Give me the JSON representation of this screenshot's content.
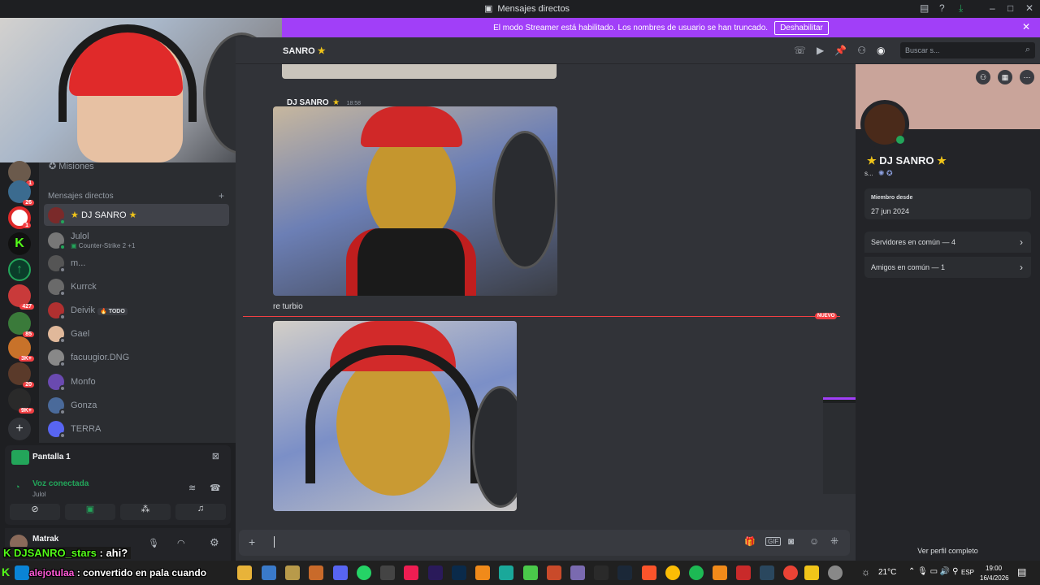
{
  "window": {
    "title": "Mensajes directos"
  },
  "banner": {
    "text": "El modo Streamer está habilitado. Los nombres de usuario se han truncado.",
    "button": "Deshabilitar"
  },
  "sidebar": {
    "missions": "Misiones",
    "section": "Mensajes directos",
    "dms": [
      {
        "name": "DJ SANRO",
        "sub": ""
      },
      {
        "name": "Julol",
        "sub": "Counter-Strike 2 +1"
      },
      {
        "name": "m...",
        "sub": ""
      },
      {
        "name": "Kurrck",
        "sub": ""
      },
      {
        "name": "Deivik",
        "sub": "",
        "tag": "TODO"
      },
      {
        "name": "Gael",
        "sub": ""
      },
      {
        "name": "facuugior.DNG",
        "sub": ""
      },
      {
        "name": "Monfo",
        "sub": ""
      },
      {
        "name": "Gonza",
        "sub": ""
      },
      {
        "name": "TERRA",
        "sub": ""
      }
    ],
    "server_badges": [
      "1",
      "26",
      "1",
      "",
      "",
      "427",
      "85",
      "3K+",
      "20",
      "9K+"
    ]
  },
  "voice": {
    "screen": "Pantalla 1",
    "status": "Voz conectada",
    "channel": "Julol"
  },
  "userbar": {
    "name": "Matrak"
  },
  "chat": {
    "header_name": "SANRO",
    "search_placeholder": "Buscar s...",
    "message": {
      "author": "DJ SANRO",
      "time": "18:58",
      "text": "re turbio"
    },
    "new_label": "NUEVO"
  },
  "profile": {
    "name": "DJ SANRO",
    "short": "s...",
    "member_since_label": "Miembro desde",
    "member_since": "27 jun 2024",
    "servers": "Servidores en común — 4",
    "friends": "Amigos en común — 1",
    "full_profile": "Ver perfil completo"
  },
  "overlay": {
    "line1_user": "DJSANRO_stars",
    "line1_text": " : ahi?",
    "line2_user": "alejotulaa",
    "line2_text": " : convertido en pala cuando"
  },
  "taskbar": {
    "weather": "21°C",
    "lang": "ESP",
    "time": "19:00",
    "date": "16/4/2026"
  },
  "colors": {
    "accent": "#a13ff8",
    "online": "#23a55a",
    "danger": "#f23f43"
  }
}
